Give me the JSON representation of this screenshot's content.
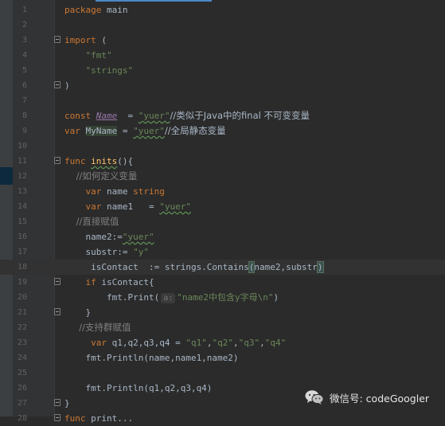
{
  "editor": {
    "lines": [
      {
        "num": "1",
        "tokens": [
          {
            "t": "package",
            "c": "kw"
          },
          {
            "t": " main"
          }
        ]
      },
      {
        "num": "2",
        "tokens": []
      },
      {
        "num": "3",
        "fold": true,
        "tokens": [
          {
            "t": "import",
            "c": "kw"
          },
          {
            "t": " ("
          }
        ]
      },
      {
        "num": "4",
        "tokens": [
          {
            "t": "    "
          },
          {
            "t": "\"fmt\"",
            "c": "str"
          }
        ]
      },
      {
        "num": "5",
        "tokens": [
          {
            "t": "    "
          },
          {
            "t": "\"strings\"",
            "c": "str"
          }
        ]
      },
      {
        "num": "6",
        "fold": true,
        "tokens": [
          {
            "t": ")"
          }
        ]
      },
      {
        "num": "7",
        "tokens": []
      },
      {
        "num": "8",
        "tokens": [
          {
            "t": "const",
            "c": "kw"
          },
          {
            "t": " "
          },
          {
            "t": "Name",
            "c": "const-name"
          },
          {
            "t": "  = "
          },
          {
            "t": "\"yuer\"",
            "c": "str typo"
          },
          {
            "t": "//类似于Java中的final 不可变变量",
            "c": "cmt-cn"
          }
        ]
      },
      {
        "num": "9",
        "tokens": [
          {
            "t": "var",
            "c": "kw"
          },
          {
            "t": " "
          },
          {
            "t": "MyName",
            "c": "myname"
          },
          {
            "t": " = "
          },
          {
            "t": "\"yuer\"",
            "c": "str typo"
          },
          {
            "t": "//全局静态变量",
            "c": "cmt-cn"
          }
        ]
      },
      {
        "num": "10",
        "tokens": []
      },
      {
        "num": "11",
        "fold": true,
        "tokens": [
          {
            "t": "func",
            "c": "kw"
          },
          {
            "t": " "
          },
          {
            "t": "inits",
            "c": "fn typo"
          },
          {
            "t": "(){"
          }
        ]
      },
      {
        "num": "12",
        "tokens": [
          {
            "t": "    //如何定义变量",
            "c": "cmt cmt-cn"
          }
        ]
      },
      {
        "num": "13",
        "tokens": [
          {
            "t": "    "
          },
          {
            "t": "var",
            "c": "kw"
          },
          {
            "t": " name "
          },
          {
            "t": "string",
            "c": "typ"
          }
        ]
      },
      {
        "num": "14",
        "tokens": [
          {
            "t": "    "
          },
          {
            "t": "var",
            "c": "kw"
          },
          {
            "t": " name1   = "
          },
          {
            "t": "\"yuer\"",
            "c": "str typo"
          }
        ]
      },
      {
        "num": "15",
        "tokens": [
          {
            "t": "    //直接赋值",
            "c": "cmt cmt-cn"
          }
        ]
      },
      {
        "num": "16",
        "tokens": [
          {
            "t": "    name2:="
          },
          {
            "t": "\"yuer\"",
            "c": "str typo"
          }
        ]
      },
      {
        "num": "17",
        "tokens": [
          {
            "t": "    substr:= "
          },
          {
            "t": "\"y\"",
            "c": "str"
          }
        ]
      },
      {
        "num": "18",
        "current": true,
        "tokens": [
          {
            "t": "     isContact  := strings.Contains"
          },
          {
            "t": "(",
            "c": "paren-hl"
          },
          {
            "t": "name2,substr"
          },
          {
            "t": ")",
            "c": "paren-hl"
          }
        ]
      },
      {
        "num": "19",
        "fold": true,
        "tokens": [
          {
            "t": "    "
          },
          {
            "t": "if",
            "c": "kw"
          },
          {
            "t": " isContact{"
          }
        ]
      },
      {
        "num": "20",
        "tokens": [
          {
            "t": "        fmt.Print("
          },
          {
            "t": "a:",
            "c": "hint"
          },
          {
            "t": "\"name2中包含y字母\\n\"",
            "c": "str"
          },
          {
            "t": ")"
          }
        ]
      },
      {
        "num": "21",
        "fold": true,
        "tokens": [
          {
            "t": "    }"
          }
        ]
      },
      {
        "num": "22",
        "tokens": [
          {
            "t": "     //支持群赋值",
            "c": "cmt cmt-cn"
          }
        ]
      },
      {
        "num": "23",
        "tokens": [
          {
            "t": "     "
          },
          {
            "t": "var",
            "c": "kw"
          },
          {
            "t": " q1,q2,q3,q4 = "
          },
          {
            "t": "\"q1\"",
            "c": "str"
          },
          {
            "t": ","
          },
          {
            "t": "\"q2\"",
            "c": "str"
          },
          {
            "t": ","
          },
          {
            "t": "\"q3\"",
            "c": "str"
          },
          {
            "t": ","
          },
          {
            "t": "\"q4\"",
            "c": "str"
          }
        ]
      },
      {
        "num": "24",
        "tokens": [
          {
            "t": "    fmt.Println(name,name1,name2)"
          }
        ]
      },
      {
        "num": "25",
        "tokens": []
      },
      {
        "num": "26",
        "tokens": [
          {
            "t": "    fmt.Println(q1,q2,q3,q4)"
          }
        ]
      },
      {
        "num": "27",
        "fold": true,
        "tokens": [
          {
            "t": "}"
          }
        ]
      },
      {
        "num": "28",
        "fold": true,
        "tokens": [
          {
            "t": "func",
            "c": "kw"
          },
          {
            "t": " print..."
          }
        ]
      }
    ]
  },
  "watermark": {
    "icon": "wechat-icon",
    "text": "微信号: codeGoogler"
  },
  "colors": {
    "background": "#2b2b2b",
    "keyword": "#cc7832",
    "string": "#6a8759",
    "comment": "#808080",
    "function": "#ffc66d"
  }
}
